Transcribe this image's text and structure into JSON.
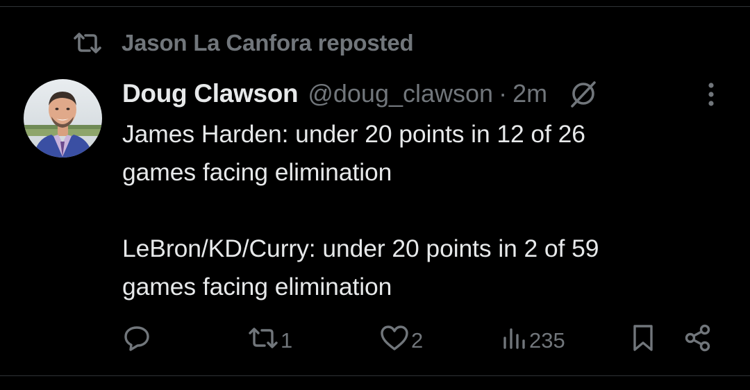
{
  "repost": {
    "text": "Jason La Canfora reposted",
    "icon": "repost-icon"
  },
  "tweet": {
    "author": {
      "display_name": "Doug Clawson",
      "handle": "@doug_clawson",
      "avatar_icon": "avatar"
    },
    "separator": "·",
    "timestamp": "2m",
    "lines": {
      "line1": "James Harden: under 20 points in 12 of 26",
      "line2": "games facing elimination",
      "line3": "LeBron/KD/Curry: under 20 points in 2 of 59",
      "line4": "games facing elimination"
    },
    "actions": {
      "reply_count": "",
      "repost_count": "1",
      "like_count": "2",
      "views_count": "235"
    }
  },
  "colors": {
    "background": "#000000",
    "primary_text": "#e7e9ea",
    "secondary_text": "#71767b",
    "divider": "#2f3336"
  }
}
